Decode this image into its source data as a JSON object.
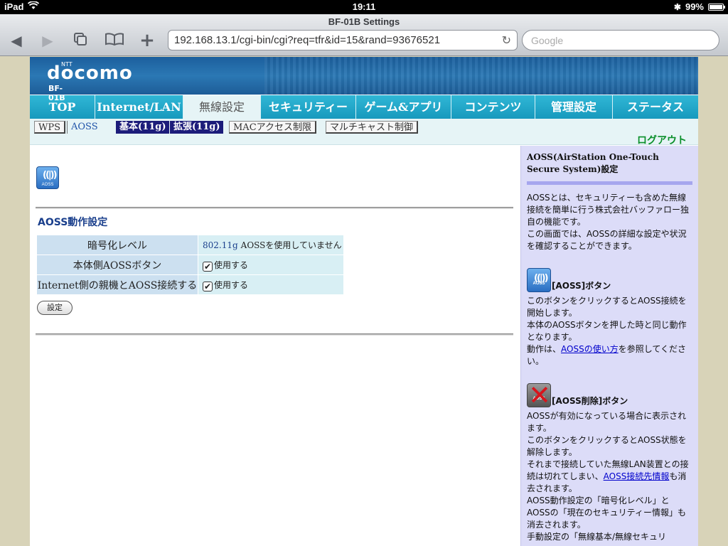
{
  "status_bar": {
    "device": "iPad",
    "time": "19:11",
    "battery": "99%",
    "battery_level": 0.99
  },
  "browser": {
    "title": "BF-01B Settings",
    "url": "192.168.13.1/cgi-bin/cgi?req=tfr&id=15&rand=93676521",
    "search_placeholder": "Google"
  },
  "header": {
    "ntt": "NTT",
    "brand": "docomo",
    "model": "BF-01B"
  },
  "main_nav": [
    {
      "label": "TOP",
      "active": false
    },
    {
      "label": "Internet/LAN",
      "active": false
    },
    {
      "label": "無線設定",
      "active": true
    },
    {
      "label": "セキュリティー",
      "active": false
    },
    {
      "label": "ゲーム&アプリ",
      "active": false
    },
    {
      "label": "コンテンツ",
      "active": false
    },
    {
      "label": "管理設定",
      "active": false
    },
    {
      "label": "ステータス",
      "active": false
    }
  ],
  "sub_nav": {
    "wps": "WPS",
    "aoss": "AOSS",
    "basic": "基本(11g)",
    "extended": "拡張(11g)",
    "mac": "MACアクセス制限",
    "multicast": "マルチキャスト制御",
    "logout": "ログアウト"
  },
  "main": {
    "icon_label": "AOSS",
    "section_title": "AOSS動作設定",
    "rows": [
      {
        "label": "暗号化レベル",
        "std": "802.11g",
        "value": "AOSSを使用していません"
      },
      {
        "label": "本体側AOSSボタン",
        "checkbox_label": "使用する",
        "checked": true
      },
      {
        "label": "Internet側の親機とAOSS接続する",
        "checkbox_label": "使用する",
        "checked": true
      }
    ],
    "set_button": "設定"
  },
  "help": {
    "title": "AOSS(AirStation One-Touch Secure System)設定",
    "intro1": "AOSSとは、セキュリティーも含めた無線接続を簡単に行う株式会社バッファロー独自の機能です。",
    "intro2": "この画面では、AOSSの詳細な設定や状況を確認することができます。",
    "aoss_button_heading": "[AOSS]ボタン",
    "aoss_button_text1": "このボタンをクリックするとAOSS接続を開始します。",
    "aoss_button_text2": "本体のAOSSボタンを押した時と同じ動作となります。",
    "aoss_button_text3_pre": "動作は、",
    "aoss_button_link": "AOSSの使い方",
    "aoss_button_text3_post": "を参照してください。",
    "delete_heading": "[AOSS削除]ボタン",
    "delete_text1": "AOSSが有効になっている場合に表示されます。",
    "delete_text2": "このボタンをクリックするとAOSS状態を解除します。",
    "delete_text3_pre": "それまで接続していた無線LAN装置との接続は切れてしまい、",
    "delete_link": "AOSS接続先情報",
    "delete_text3_post": "も消去されます。",
    "delete_text4": "AOSS動作設定の「暗号化レベル」とAOSSの「現在のセキュリティー情報」も消去されます。",
    "delete_text5": "手動設定の「無線基本/無線セキュリ"
  }
}
